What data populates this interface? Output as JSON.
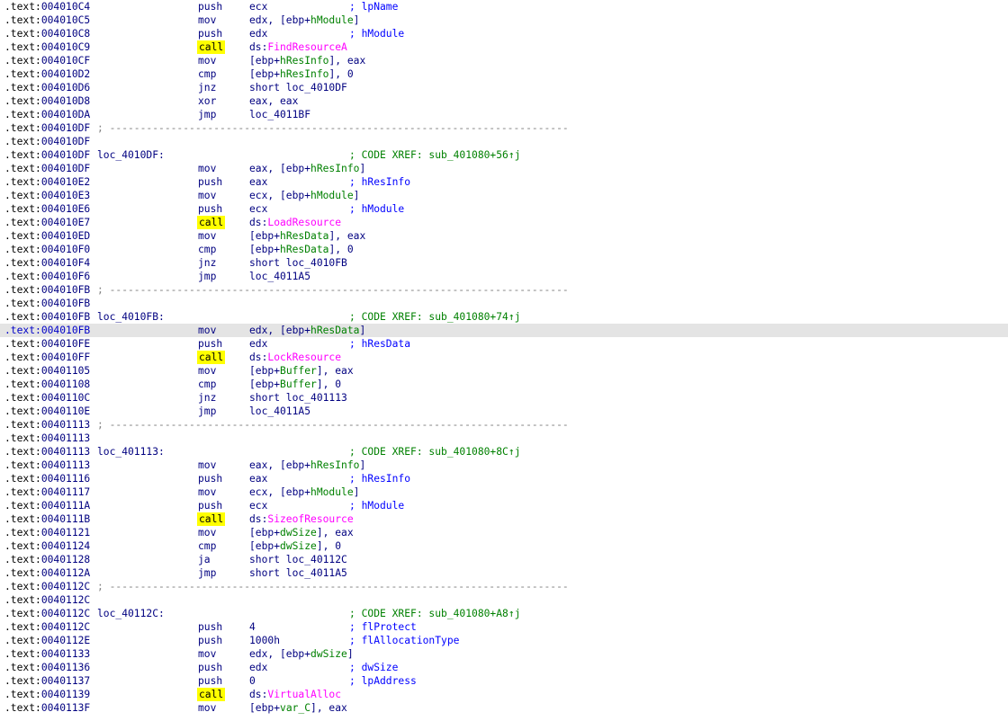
{
  "colors": {
    "background": "#ffffff",
    "address": "#000080",
    "mnemonic": "#000080",
    "variable": "#008000",
    "import_function": "#ff00ff",
    "comment": "#0000ff",
    "xref_comment": "#008000",
    "call_highlight": "#ffff00",
    "current_line": "#e4e4e4",
    "separator": "#808080"
  },
  "lines": [
    {
      "addr": "004010C4",
      "mn": "push",
      "op": [
        {
          "t": "ecx"
        }
      ],
      "cmt": "; lpName"
    },
    {
      "addr": "004010C5",
      "mn": "mov",
      "op": [
        {
          "t": "edx, [ebp+"
        },
        {
          "t": "hModule",
          "c": "var"
        },
        {
          "t": "]"
        }
      ]
    },
    {
      "addr": "004010C8",
      "mn": "push",
      "op": [
        {
          "t": "edx"
        }
      ],
      "cmt": "; hModule"
    },
    {
      "addr": "004010C9",
      "mn": "call",
      "op": [
        {
          "t": "ds:"
        },
        {
          "t": "FindResourceA",
          "c": "fn"
        }
      ]
    },
    {
      "addr": "004010CF",
      "mn": "mov",
      "op": [
        {
          "t": "[ebp+"
        },
        {
          "t": "hResInfo",
          "c": "var"
        },
        {
          "t": "], eax"
        }
      ]
    },
    {
      "addr": "004010D2",
      "mn": "cmp",
      "op": [
        {
          "t": "[ebp+"
        },
        {
          "t": "hResInfo",
          "c": "var"
        },
        {
          "t": "], 0"
        }
      ]
    },
    {
      "addr": "004010D6",
      "mn": "jnz",
      "op": [
        {
          "t": "short loc_4010DF"
        }
      ]
    },
    {
      "addr": "004010D8",
      "mn": "xor",
      "op": [
        {
          "t": "eax, eax"
        }
      ]
    },
    {
      "addr": "004010DA",
      "mn": "jmp",
      "op": [
        {
          "t": "loc_4011BF"
        }
      ]
    },
    {
      "addr": "004010DF",
      "sep": "; ---------------------------------------------------------------------------"
    },
    {
      "addr": "004010DF"
    },
    {
      "addr": "004010DF",
      "lbl": "loc_4010DF:",
      "xref": "; CODE XREF: sub_401080+56↑j"
    },
    {
      "addr": "004010DF",
      "mn": "mov",
      "op": [
        {
          "t": "eax, [ebp+"
        },
        {
          "t": "hResInfo",
          "c": "var"
        },
        {
          "t": "]"
        }
      ]
    },
    {
      "addr": "004010E2",
      "mn": "push",
      "op": [
        {
          "t": "eax"
        }
      ],
      "cmt": "; hResInfo"
    },
    {
      "addr": "004010E3",
      "mn": "mov",
      "op": [
        {
          "t": "ecx, [ebp+"
        },
        {
          "t": "hModule",
          "c": "var"
        },
        {
          "t": "]"
        }
      ]
    },
    {
      "addr": "004010E6",
      "mn": "push",
      "op": [
        {
          "t": "ecx"
        }
      ],
      "cmt": "; hModule"
    },
    {
      "addr": "004010E7",
      "mn": "call",
      "op": [
        {
          "t": "ds:"
        },
        {
          "t": "LoadResource",
          "c": "fn"
        }
      ]
    },
    {
      "addr": "004010ED",
      "mn": "mov",
      "op": [
        {
          "t": "[ebp+"
        },
        {
          "t": "hResData",
          "c": "var"
        },
        {
          "t": "], eax"
        }
      ]
    },
    {
      "addr": "004010F0",
      "mn": "cmp",
      "op": [
        {
          "t": "[ebp+"
        },
        {
          "t": "hResData",
          "c": "var"
        },
        {
          "t": "], 0"
        }
      ]
    },
    {
      "addr": "004010F4",
      "mn": "jnz",
      "op": [
        {
          "t": "short loc_4010FB"
        }
      ]
    },
    {
      "addr": "004010F6",
      "mn": "jmp",
      "op": [
        {
          "t": "loc_4011A5"
        }
      ]
    },
    {
      "addr": "004010FB",
      "sep": "; ---------------------------------------------------------------------------"
    },
    {
      "addr": "004010FB"
    },
    {
      "addr": "004010FB",
      "lbl": "loc_4010FB:",
      "xref": "; CODE XREF: sub_401080+74↑j"
    },
    {
      "addr": "004010FB",
      "mn": "mov",
      "op": [
        {
          "t": "edx, [ebp+"
        },
        {
          "t": "hResData",
          "c": "var"
        },
        {
          "t": "]"
        }
      ],
      "current": true
    },
    {
      "addr": "004010FE",
      "mn": "push",
      "op": [
        {
          "t": "edx"
        }
      ],
      "cmt": "; hResData"
    },
    {
      "addr": "004010FF",
      "mn": "call",
      "op": [
        {
          "t": "ds:"
        },
        {
          "t": "LockResource",
          "c": "fn"
        }
      ]
    },
    {
      "addr": "00401105",
      "mn": "mov",
      "op": [
        {
          "t": "[ebp+"
        },
        {
          "t": "Buffer",
          "c": "var"
        },
        {
          "t": "], eax"
        }
      ]
    },
    {
      "addr": "00401108",
      "mn": "cmp",
      "op": [
        {
          "t": "[ebp+"
        },
        {
          "t": "Buffer",
          "c": "var"
        },
        {
          "t": "], 0"
        }
      ]
    },
    {
      "addr": "0040110C",
      "mn": "jnz",
      "op": [
        {
          "t": "short loc_401113"
        }
      ]
    },
    {
      "addr": "0040110E",
      "mn": "jmp",
      "op": [
        {
          "t": "loc_4011A5"
        }
      ]
    },
    {
      "addr": "00401113",
      "sep": "; ---------------------------------------------------------------------------"
    },
    {
      "addr": "00401113"
    },
    {
      "addr": "00401113",
      "lbl": "loc_401113:",
      "xref": "; CODE XREF: sub_401080+8C↑j"
    },
    {
      "addr": "00401113",
      "mn": "mov",
      "op": [
        {
          "t": "eax, [ebp+"
        },
        {
          "t": "hResInfo",
          "c": "var"
        },
        {
          "t": "]"
        }
      ]
    },
    {
      "addr": "00401116",
      "mn": "push",
      "op": [
        {
          "t": "eax"
        }
      ],
      "cmt": "; hResInfo"
    },
    {
      "addr": "00401117",
      "mn": "mov",
      "op": [
        {
          "t": "ecx, [ebp+"
        },
        {
          "t": "hModule",
          "c": "var"
        },
        {
          "t": "]"
        }
      ]
    },
    {
      "addr": "0040111A",
      "mn": "push",
      "op": [
        {
          "t": "ecx"
        }
      ],
      "cmt": "; hModule"
    },
    {
      "addr": "0040111B",
      "mn": "call",
      "op": [
        {
          "t": "ds:"
        },
        {
          "t": "SizeofResource",
          "c": "fn"
        }
      ]
    },
    {
      "addr": "00401121",
      "mn": "mov",
      "op": [
        {
          "t": "[ebp+"
        },
        {
          "t": "dwSize",
          "c": "var"
        },
        {
          "t": "], eax"
        }
      ]
    },
    {
      "addr": "00401124",
      "mn": "cmp",
      "op": [
        {
          "t": "[ebp+"
        },
        {
          "t": "dwSize",
          "c": "var"
        },
        {
          "t": "], 0"
        }
      ]
    },
    {
      "addr": "00401128",
      "mn": "ja",
      "op": [
        {
          "t": "short loc_40112C"
        }
      ]
    },
    {
      "addr": "0040112A",
      "mn": "jmp",
      "op": [
        {
          "t": "short loc_4011A5"
        }
      ]
    },
    {
      "addr": "0040112C",
      "sep": "; ---------------------------------------------------------------------------"
    },
    {
      "addr": "0040112C"
    },
    {
      "addr": "0040112C",
      "lbl": "loc_40112C:",
      "xref": "; CODE XREF: sub_401080+A8↑j"
    },
    {
      "addr": "0040112C",
      "mn": "push",
      "op": [
        {
          "t": "4"
        }
      ],
      "cmt": "; flProtect"
    },
    {
      "addr": "0040112E",
      "mn": "push",
      "op": [
        {
          "t": "1000h"
        }
      ],
      "cmt": "; flAllocationType"
    },
    {
      "addr": "00401133",
      "mn": "mov",
      "op": [
        {
          "t": "edx, [ebp+"
        },
        {
          "t": "dwSize",
          "c": "var"
        },
        {
          "t": "]"
        }
      ]
    },
    {
      "addr": "00401136",
      "mn": "push",
      "op": [
        {
          "t": "edx"
        }
      ],
      "cmt": "; dwSize"
    },
    {
      "addr": "00401137",
      "mn": "push",
      "op": [
        {
          "t": "0"
        }
      ],
      "cmt": "; lpAddress"
    },
    {
      "addr": "00401139",
      "mn": "call",
      "op": [
        {
          "t": "ds:"
        },
        {
          "t": "VirtualAlloc",
          "c": "fn"
        }
      ]
    },
    {
      "addr": "0040113F",
      "mn": "mov",
      "op": [
        {
          "t": "[ebp+"
        },
        {
          "t": "var_C",
          "c": "var"
        },
        {
          "t": "], eax"
        }
      ]
    }
  ]
}
